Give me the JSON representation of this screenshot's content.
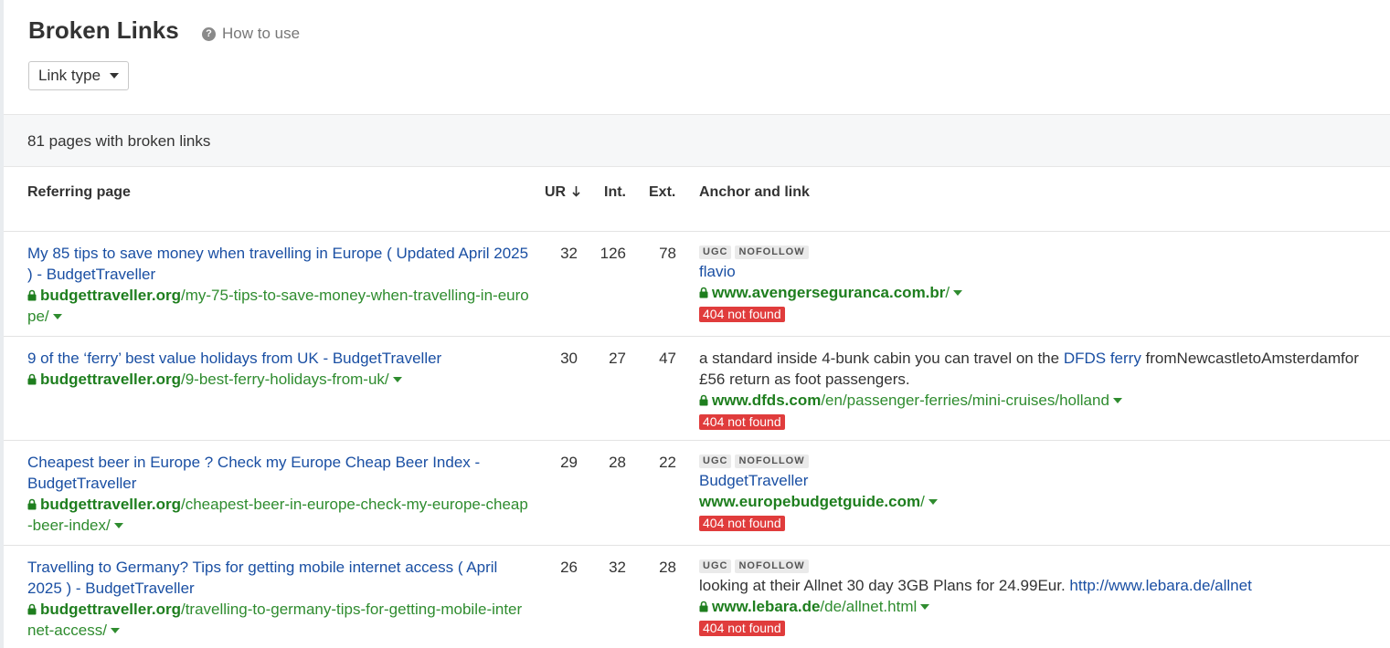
{
  "header": {
    "title": "Broken Links",
    "howto_label": "How to use",
    "link_type_label": "Link type"
  },
  "summary": {
    "text": "81 pages with broken links"
  },
  "table": {
    "headers": {
      "referring_page": "Referring page",
      "ur": "UR",
      "int": "Int.",
      "ext": "Ext.",
      "anchor": "Anchor and link"
    },
    "rows": [
      {
        "title": "My 85 tips to save money when travelling in Europe ( Updated April 2025 ) - BudgetTraveller",
        "domain": "budgettraveller.org",
        "path": "/my-75-tips-to-save-money-when-travelling-in-europe/",
        "ur": "32",
        "int": "126",
        "ext": "78",
        "tag1": "UGC",
        "tag2": "NOFOLLOW",
        "anchor": "flavio",
        "link_domain": "www.avengerseguranca.com.br",
        "link_path": "/",
        "status": "404 not found"
      },
      {
        "title": "9 of the ‘ferry’ best value holidays from UK - BudgetTraveller",
        "domain": "budgettraveller.org",
        "path": "/9-best-ferry-holidays-from-uk/",
        "ur": "30",
        "int": "27",
        "ext": "47",
        "anchor_before": "a standard inside 4-bunk cabin you can travel on the ",
        "anchor_link": "DFDS ferry",
        "anchor_after": " fromNewcastletoAmsterdamfor £56 return as foot passengers.",
        "link_domain": "www.dfds.com",
        "link_path": "/en/passenger-ferries/mini-cruises/holland",
        "status": "404 not found"
      },
      {
        "title": "Cheapest beer in Europe ? Check my Europe Cheap Beer Index - BudgetTraveller",
        "domain": "budgettraveller.org",
        "path": "/cheapest-beer-in-europe-check-my-europe-cheap-beer-index/",
        "ur": "29",
        "int": "28",
        "ext": "22",
        "tag1": "UGC",
        "tag2": "NOFOLLOW",
        "anchor": "BudgetTraveller",
        "link_domain": "www.europebudgetguide.com",
        "link_path": "/",
        "status": "404 not found"
      },
      {
        "title": "Travelling to Germany? Tips for getting mobile internet access ( April 2025 ) - BudgetTraveller",
        "domain": "budgettraveller.org",
        "path": "/travelling-to-germany-tips-for-getting-mobile-internet-access/",
        "ur": "26",
        "int": "32",
        "ext": "28",
        "tag1": "UGC",
        "tag2": "NOFOLLOW",
        "anchor_before": "looking at their Allnet 30 day 3GB Plans for 24.99Eur. ",
        "anchor_link": "http://www.lebara.de/allnet",
        "link_domain": "www.lebara.de",
        "link_path": "/de/allnet.html",
        "status": "404 not found"
      }
    ]
  },
  "icons": {
    "help": "question-icon",
    "dropdown": "caret-down-icon",
    "sort": "arrow-down-icon",
    "secure": "lock-icon",
    "expand": "caret-down-icon"
  },
  "colors": {
    "link_blue": "#1a4fa3",
    "url_green": "#2f8c2f",
    "status_red": "#e03c3c"
  }
}
